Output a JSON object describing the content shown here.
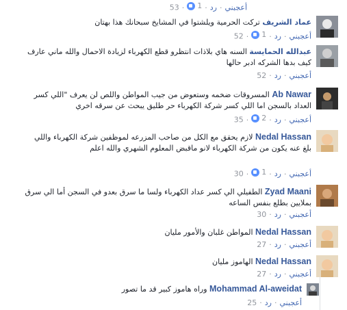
{
  "action_labels": {
    "like": "أعجبني",
    "reply": "رد",
    "separator": "·"
  },
  "comments": [
    {
      "author": "",
      "text": "",
      "reactions": "1",
      "age": "53"
    },
    {
      "author": "عماد الشريف",
      "text": "تركت الحرمية ويلشتوا في المشايخ سبحانك هذا بهتان",
      "reactions": "1",
      "age": "52"
    },
    {
      "author": "عبدالله الحمايسة",
      "text": "السنه هاي بلاذات انتظرو قطع الكهرباء لزيادة الاحمال والله ماني عارف كيف بدها الشركه ادبر حالها",
      "reactions": "",
      "age": "52"
    },
    {
      "author": "Ab Nawar",
      "text": "المسروقات ضخمه وستعوض من جيب المواطن واللص لن يعرف \"اللي كسر العداد بالسجن اما اللي كسر شركة الكهرباء حر طليق يبحث عن سرقه اخري",
      "reactions": "2",
      "age": "35"
    },
    {
      "author": "Nedal Hassan",
      "text": "لازم يحقق مع الكل من صاحب المزرعه لموظفين شركة الكهرباء واللي بلغ عنه يكون من شركة الكهرباء لانو ماقبض المعلوم الشهري والله اعلم",
      "reactions": "1",
      "age": "30"
    },
    {
      "author": "Zyad Maani",
      "text": "الطفيلي الي كسر عداد الكهرباء ولسا ما سرق بعدو في السجن أما الي سرق بملايين بطلع بنفس الساعه",
      "reactions": "",
      "age": "30"
    },
    {
      "author": "Nedal Hassan",
      "text": "المواطن غلبان والأمور مليان",
      "reactions": "",
      "age": "27"
    },
    {
      "author": "Nedal Hassan",
      "text": "الهاموز مليان",
      "reactions": "",
      "age": "27"
    },
    {
      "author": "Mohammad Al-aweidat",
      "text": "وراه هاموز كبير قد ما تصور",
      "reactions": "",
      "age": "25"
    }
  ],
  "colors": {
    "link": "#365899",
    "meta": "#90949c",
    "like_badge": "#5890ff"
  }
}
